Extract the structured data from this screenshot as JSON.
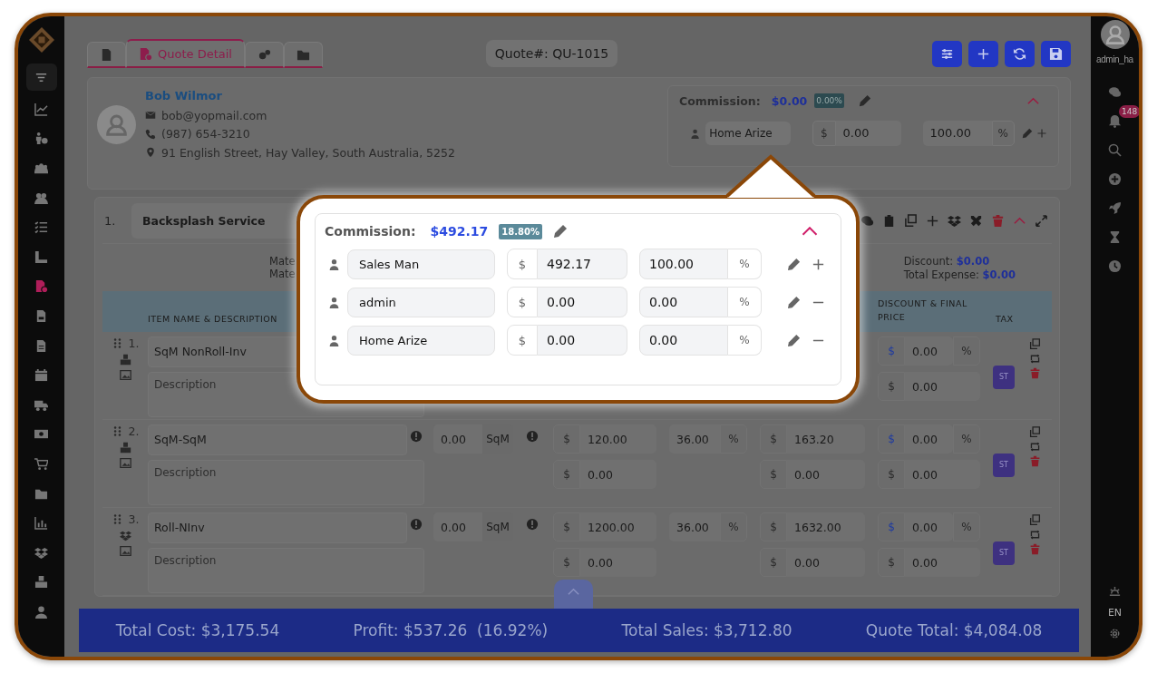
{
  "tabs": [
    {
      "selected": false
    },
    {
      "label": "Quote Detail",
      "selected": true
    },
    {
      "selected": false
    },
    {
      "selected": false
    }
  ],
  "quote_number": "Quote#: QU-1015",
  "customer": {
    "name": "Bob Wilmor",
    "email": "bob@yopmail.com",
    "phone": "(987) 654-3210",
    "address": "91 English Street, Hay Valley, South Australia, 5252"
  },
  "commission": {
    "label": "Commission:",
    "amount": "$0.00",
    "percent": "0.00%",
    "expanded": true,
    "rows": [
      {
        "name": "Home Arize",
        "currency": "$",
        "amount": "0.00",
        "share": "100.00",
        "unit": "%",
        "kind": "add"
      }
    ]
  },
  "section": {
    "number": "1.",
    "name": "Backsplash Service",
    "expanded": true,
    "summary_left": [
      "Mate",
      "Mate"
    ],
    "discount_label": "Discount:",
    "discount": "$0.00",
    "expense_label": "Total Expense:",
    "expense": "$0.00"
  },
  "table": {
    "columns": [
      "ITEM NAME & DESCRIPTION",
      "DISCOUNT & FINAL PRICE",
      "TAX"
    ],
    "rows": [
      {
        "number": "1.",
        "kind": "stock",
        "name": "SqM NonRoll-Inv",
        "placeholder": "Description",
        "discount": {
          "prefix": "$",
          "value": "0.00",
          "suffix": "%"
        },
        "final": {
          "prefix": "$",
          "value": "0.00"
        },
        "tax": "ST"
      },
      {
        "number": "2.",
        "kind": "stock",
        "name": "SqM-SqM",
        "placeholder": "Description",
        "qty": "0.00",
        "unit": "SqM",
        "cost": {
          "prefix": "$",
          "value": "120.00"
        },
        "markup": {
          "value": "36.00",
          "suffix": "%"
        },
        "price": {
          "prefix": "$",
          "value": "163.20"
        },
        "discount": {
          "prefix": "$",
          "value": "0.00",
          "suffix": "%"
        },
        "extra_cost": {
          "prefix": "$",
          "value": "0.00"
        },
        "extra_price": {
          "prefix": "$",
          "value": "0.00"
        },
        "final": {
          "prefix": "$",
          "value": "0.00"
        },
        "tax": "ST"
      },
      {
        "number": "3.",
        "kind": "roll",
        "name": "Roll-NInv",
        "placeholder": "Description",
        "qty": "0.00",
        "unit": "SqM",
        "cost": {
          "prefix": "$",
          "value": "1200.00"
        },
        "markup": {
          "value": "36.00",
          "suffix": "%"
        },
        "price": {
          "prefix": "$",
          "value": "1632.00"
        },
        "discount": {
          "prefix": "$",
          "value": "0.00",
          "suffix": "%"
        },
        "extra_cost": {
          "prefix": "$",
          "value": "0.00"
        },
        "extra_price": {
          "prefix": "$",
          "value": "0.00"
        },
        "final": {
          "prefix": "$",
          "value": "0.00"
        },
        "tax": "ST"
      }
    ]
  },
  "footer": [
    {
      "text": "Total Cost: $3,175.54"
    },
    {
      "text": "Profit: $537.26",
      "note": "(16.92%)"
    },
    {
      "text": "Total Sales: $3,712.80"
    },
    {
      "text": "Quote Total: $4,084.08"
    }
  ],
  "popup": {
    "label": "Commission:",
    "amount": "$492.17",
    "percent": "18.80%",
    "expanded": true,
    "rows": [
      {
        "name": "Sales Man",
        "currency": "$",
        "amount": "492.17",
        "share": "100.00",
        "unit": "%",
        "kind": "add"
      },
      {
        "name": "admin",
        "currency": "$",
        "amount": "0.00",
        "share": "0.00",
        "unit": "%",
        "kind": "remove"
      },
      {
        "name": "Home Arize",
        "currency": "$",
        "amount": "0.00",
        "share": "0.00",
        "unit": "%",
        "kind": "remove"
      }
    ]
  },
  "sidebar": {
    "items": [
      {
        "selected": false
      },
      {
        "selected": false
      },
      {
        "selected": false
      },
      {
        "selected": false
      },
      {
        "selected": false
      },
      {
        "selected": false
      },
      {
        "selected": true
      },
      {
        "selected": false
      },
      {
        "selected": false
      },
      {
        "selected": false
      },
      {
        "selected": false
      },
      {
        "selected": false
      },
      {
        "selected": false
      },
      {
        "selected": false
      },
      {
        "selected": false
      },
      {
        "selected": false
      },
      {
        "selected": false
      },
      {
        "selected": false
      }
    ]
  },
  "user": {
    "name": "admin_ha",
    "notifications": "148"
  },
  "language": "EN"
}
